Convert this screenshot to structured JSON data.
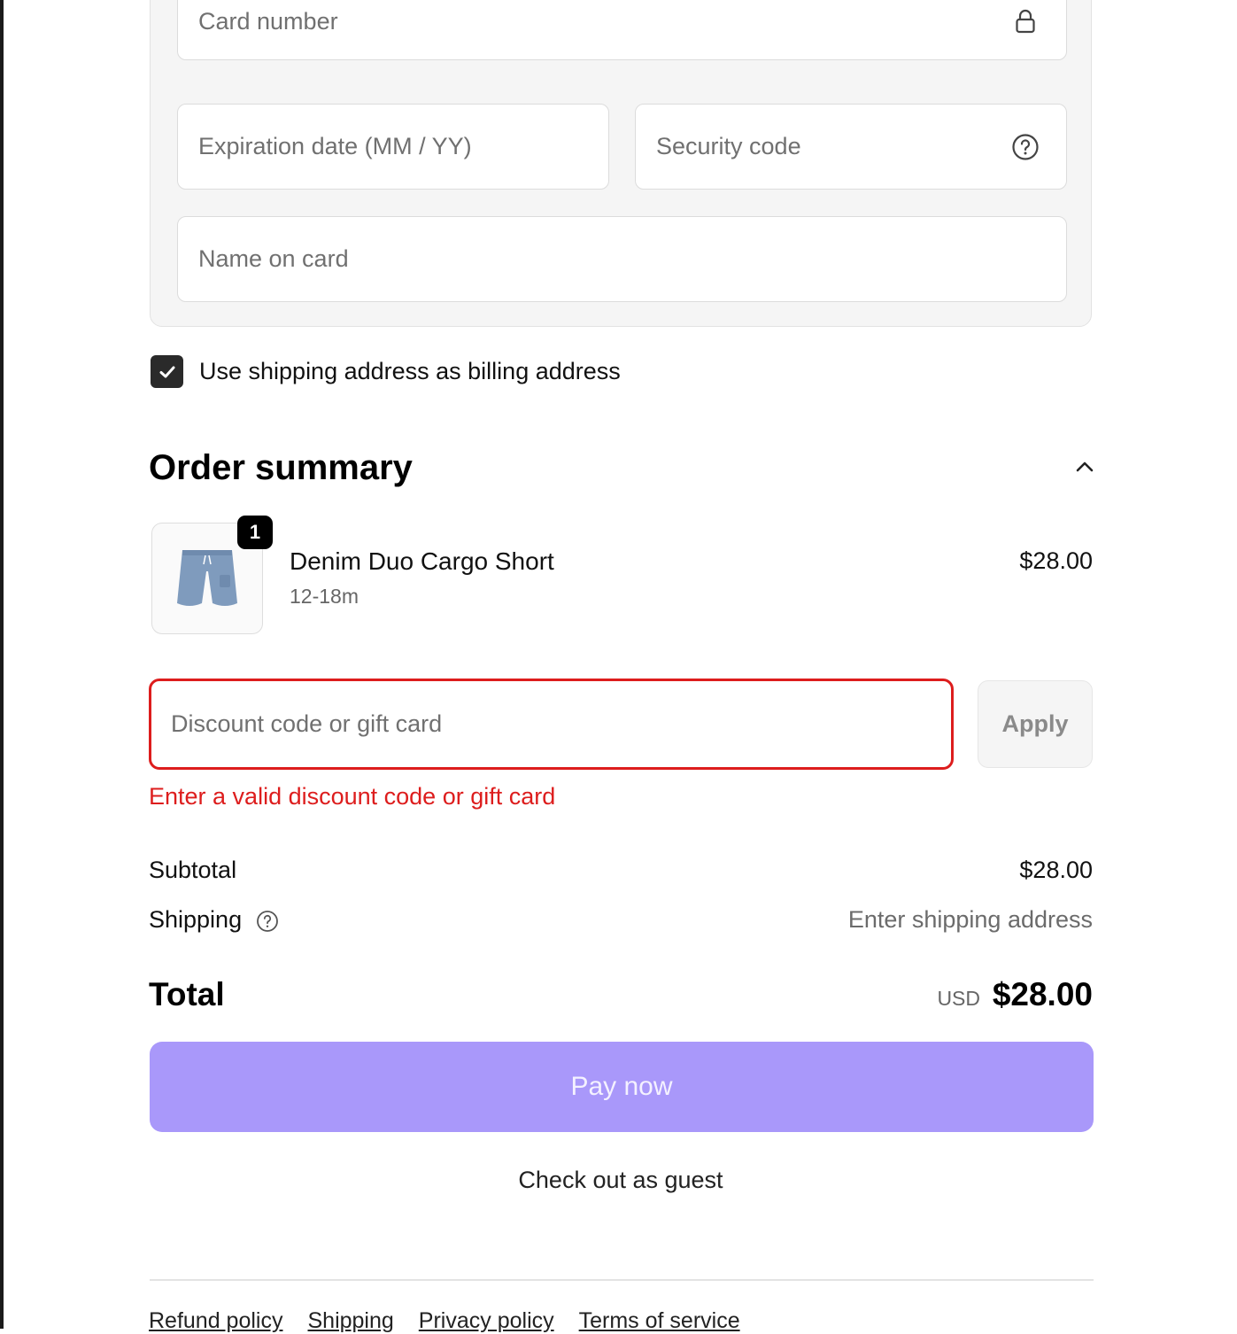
{
  "payment": {
    "card_number_placeholder": "Card number",
    "expiration_placeholder": "Expiration date (MM / YY)",
    "security_code_placeholder": "Security code",
    "name_on_card_placeholder": "Name on card"
  },
  "billing": {
    "checked": true,
    "label": "Use shipping address as billing address"
  },
  "order_summary": {
    "title": "Order summary",
    "items": [
      {
        "name": "Denim Duo Cargo Short",
        "variant": "12-18m",
        "price": "$28.00",
        "quantity": "1"
      }
    ],
    "discount": {
      "placeholder": "Discount code or gift card",
      "apply_label": "Apply",
      "error": "Enter a valid discount code or gift card"
    },
    "subtotal": {
      "label": "Subtotal",
      "value": "$28.00"
    },
    "shipping": {
      "label": "Shipping",
      "value": "Enter shipping address"
    },
    "total": {
      "label": "Total",
      "currency": "USD",
      "value": "$28.00"
    }
  },
  "actions": {
    "pay_label": "Pay now",
    "guest_label": "Check out as guest"
  },
  "footer": {
    "links": [
      "Refund policy",
      "Shipping",
      "Privacy policy",
      "Terms of service"
    ]
  },
  "colors": {
    "pay_button": "#a998fa",
    "error": "#dd1d1d",
    "checkbox": "#2a2a2a"
  }
}
